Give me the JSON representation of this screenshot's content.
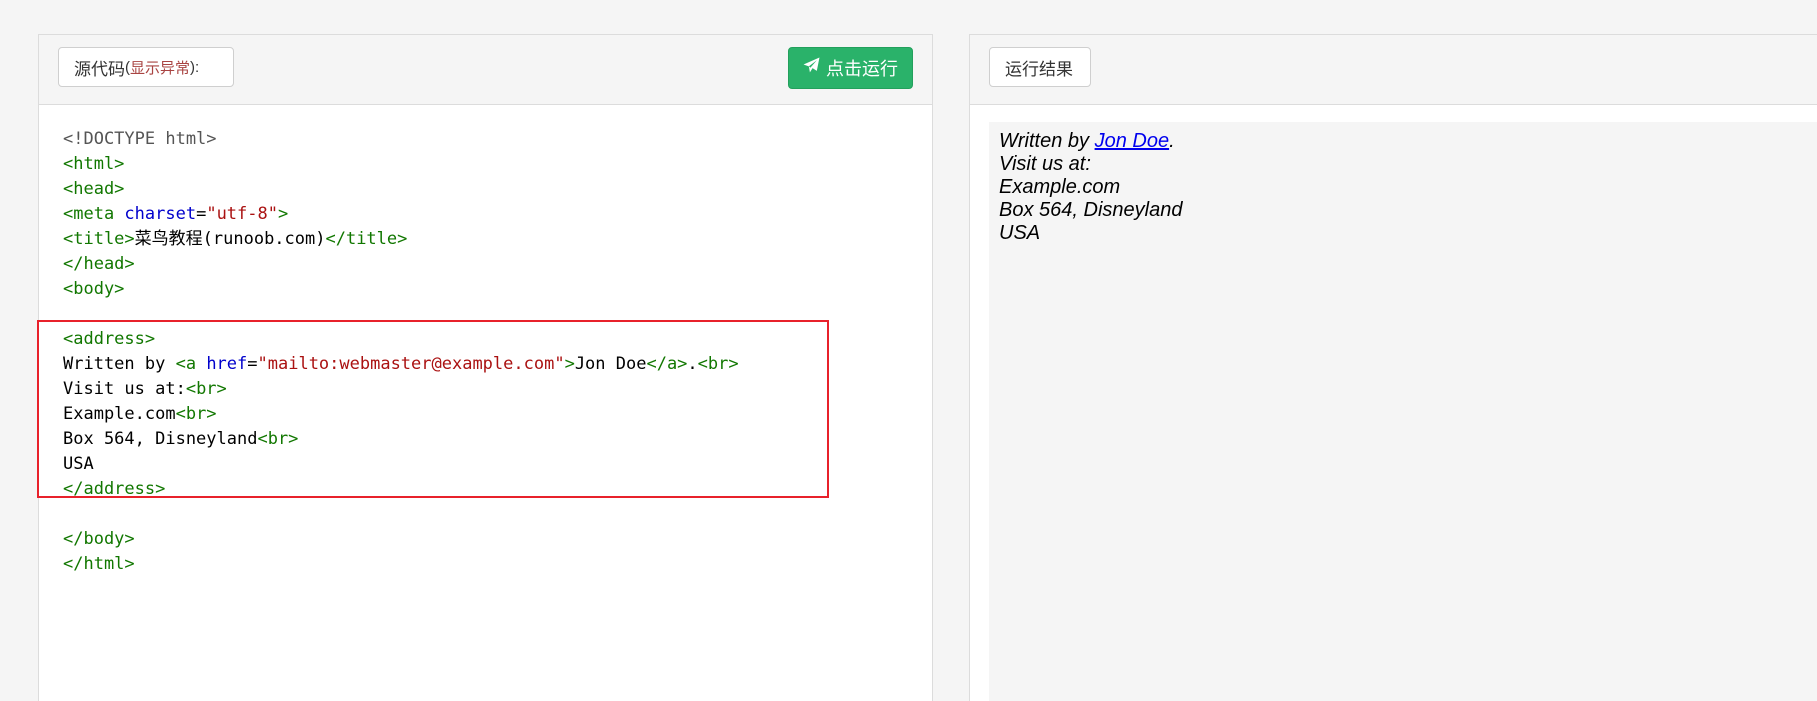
{
  "source_panel": {
    "label": "源代码",
    "paren_open": "(",
    "error_link": "显示异常",
    "paren_close": "):",
    "run_button": "点击运行"
  },
  "code_lines": [
    [
      {
        "c": "c-doc",
        "t": "<!DOCTYPE html>"
      }
    ],
    [
      {
        "c": "c-tag",
        "t": "<html>"
      }
    ],
    [
      {
        "c": "c-tag",
        "t": "<head>"
      }
    ],
    [
      {
        "c": "c-tag",
        "t": "<meta "
      },
      {
        "c": "c-attr",
        "t": "charset"
      },
      {
        "c": "c-txt",
        "t": "="
      },
      {
        "c": "c-str",
        "t": "\"utf-8\""
      },
      {
        "c": "c-tag",
        "t": ">"
      }
    ],
    [
      {
        "c": "c-tag",
        "t": "<title>"
      },
      {
        "c": "c-txt",
        "t": "菜鸟教程(runoob.com)"
      },
      {
        "c": "c-tag",
        "t": "</title>"
      }
    ],
    [
      {
        "c": "c-tag",
        "t": "</head>"
      }
    ],
    [
      {
        "c": "c-tag",
        "t": "<body>"
      }
    ],
    [],
    [
      {
        "c": "c-tag",
        "t": "<address>"
      }
    ],
    [
      {
        "c": "c-txt",
        "t": "Written by "
      },
      {
        "c": "c-tag",
        "t": "<a "
      },
      {
        "c": "c-attr",
        "t": "href"
      },
      {
        "c": "c-txt",
        "t": "="
      },
      {
        "c": "c-str",
        "t": "\"mailto:webmaster@example.com\""
      },
      {
        "c": "c-tag",
        "t": ">"
      },
      {
        "c": "c-txt",
        "t": "Jon Doe"
      },
      {
        "c": "c-tag",
        "t": "</a>"
      },
      {
        "c": "c-txt",
        "t": "."
      },
      {
        "c": "c-tag",
        "t": "<br>"
      }
    ],
    [
      {
        "c": "c-txt",
        "t": "Visit us at:"
      },
      {
        "c": "c-tag",
        "t": "<br>"
      }
    ],
    [
      {
        "c": "c-txt",
        "t": "Example.com"
      },
      {
        "c": "c-tag",
        "t": "<br>"
      }
    ],
    [
      {
        "c": "c-txt",
        "t": "Box 564, Disneyland"
      },
      {
        "c": "c-tag",
        "t": "<br>"
      }
    ],
    [
      {
        "c": "c-txt",
        "t": "USA"
      }
    ],
    [
      {
        "c": "c-tag",
        "t": "</address>"
      }
    ],
    [],
    [
      {
        "c": "c-tag",
        "t": "</body>"
      }
    ],
    [
      {
        "c": "c-tag",
        "t": "</html>"
      }
    ]
  ],
  "result_panel": {
    "label": "运行结果",
    "written_by": "Written by ",
    "link_text": "Jon Doe",
    "after_link": ".",
    "line2": "Visit us at:",
    "line3": "Example.com",
    "line4": "Box 564, Disneyland",
    "line5": "USA"
  },
  "colors": {
    "run_button": "#2ab26a",
    "highlight_border": "#e8212b",
    "error_link": "#a94442"
  },
  "icons": {
    "run_button_icon": "paper-plane-icon"
  }
}
